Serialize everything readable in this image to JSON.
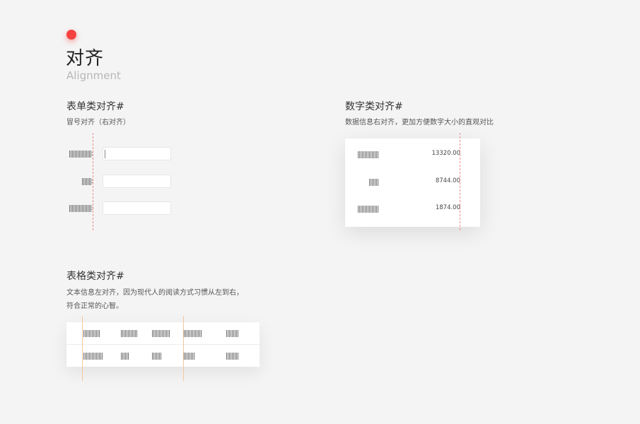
{
  "header": {
    "title": "对齐",
    "subtitle": "Alignment"
  },
  "form_section": {
    "title": "表单类对齐#",
    "desc": "冒号对齐（右对齐）",
    "rows": [
      {
        "label_ticks": 16,
        "colon": ":"
      },
      {
        "label_ticks": 7,
        "colon": ":"
      },
      {
        "label_ticks": 16,
        "colon": ":"
      }
    ]
  },
  "number_section": {
    "title": "数字类对齐#",
    "desc": "数据信息右对齐，更加方便数字大小的直观对比",
    "rows": [
      {
        "value": "13320.00"
      },
      {
        "value": "8744.00"
      },
      {
        "value": "1874.00"
      }
    ]
  },
  "table_section": {
    "title": "表格类对齐#",
    "desc_line1": "文本信息左对齐，因为现代人的阅读方式习惯从左到右，",
    "desc_line2": "符合正常的心智。"
  },
  "colors": {
    "accent": "#f5413f",
    "guide_red": "#f08b8b",
    "guide_orange": "#f3c69c"
  }
}
